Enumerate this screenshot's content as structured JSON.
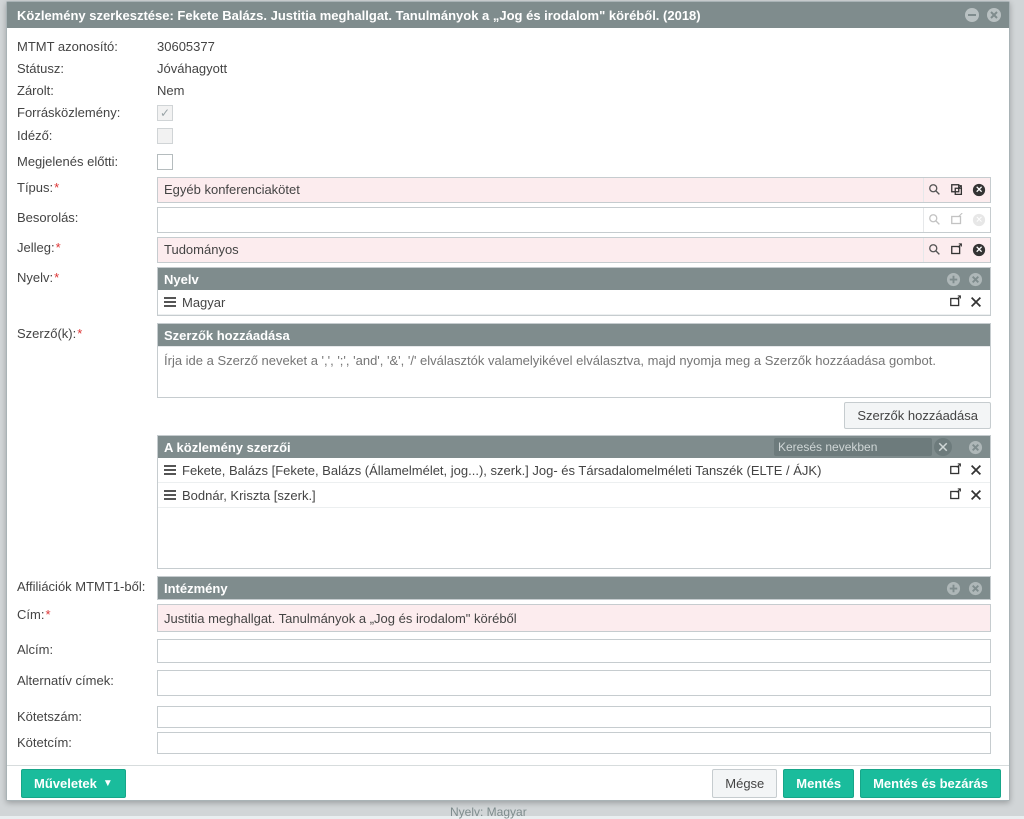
{
  "dialog": {
    "title": "Közlemény szerkesztése: Fekete Balázs. Justitia meghallgat. Tanulmányok a „Jog és irodalom\" köréből. (2018)"
  },
  "labels": {
    "mtmt_id": "MTMT azonosító:",
    "status": "Státusz:",
    "locked": "Zárolt:",
    "source_pub": "Forrásközlemény:",
    "citing": "Idéző:",
    "prepub": "Megjelenés előtti:",
    "type": "Típus:",
    "classification": "Besorolás:",
    "character": "Jelleg:",
    "language": "Nyelv:",
    "authors": "Szerző(k):",
    "affiliations": "Affiliációk MTMT1-ből:",
    "title_field": "Cím:",
    "subtitle": "Alcím:",
    "alt_titles": "Alternatív címek:",
    "volume_no": "Kötetszám:",
    "volume_title": "Kötetcím:"
  },
  "values": {
    "mtmt_id": "30605377",
    "status": "Jóváhagyott",
    "locked": "Nem",
    "type": "Egyéb konferenciakötet",
    "classification": "",
    "character": "Tudományos",
    "title": "Justitia meghallgat. Tanulmányok a „Jog és irodalom\" köréből",
    "subtitle": "",
    "volume_no": "",
    "volume_title": ""
  },
  "language_panel": {
    "header": "Nyelv",
    "items": [
      "Magyar"
    ]
  },
  "authors_add_panel": {
    "header": "Szerzők hozzáadása",
    "placeholder": "Írja ide a Szerző neveket a ',', ';', 'and', '&', '/' elválasztók valamelyikével elválasztva, majd nyomja meg a Szerzők hozzáadása gombot.",
    "button": "Szerzők hozzáadása"
  },
  "authors_panel": {
    "header": "A közlemény szerzői",
    "search_placeholder": "Keresés nevekben",
    "items": [
      "Fekete, Balázs [Fekete, Balázs (Államelmélet, jog...), szerk.] Jog- és Társadalomelméleti Tanszék (ELTE / ÁJK)",
      "Bodnár, Kriszta [szerk.]"
    ]
  },
  "institution_panel": {
    "header": "Intézmény"
  },
  "footer": {
    "operations": "Műveletek",
    "cancel": "Mégse",
    "save": "Mentés",
    "save_close": "Mentés és bezárás"
  },
  "background_hint": "Nyelv: Magyar"
}
